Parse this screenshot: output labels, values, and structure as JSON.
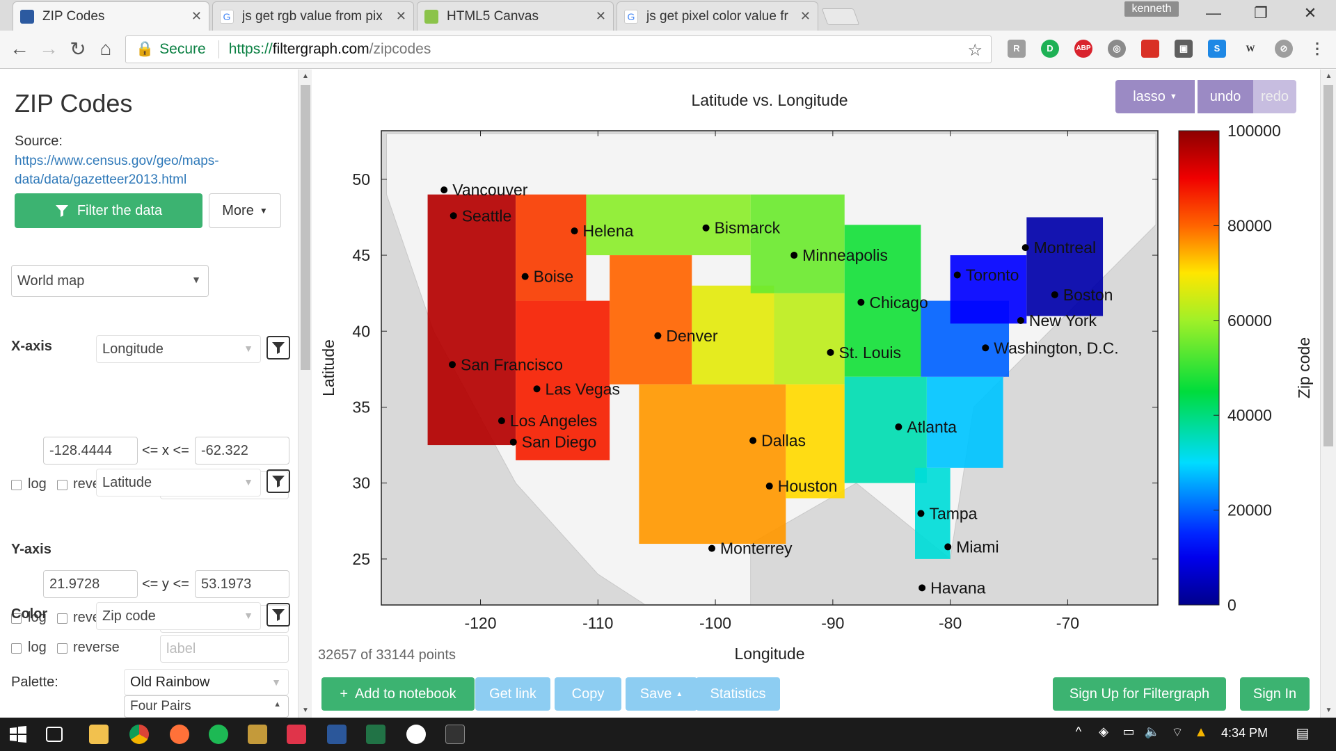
{
  "browser": {
    "tabs": [
      {
        "title": "ZIP Codes",
        "icon": "filtergraph-icon",
        "active": true
      },
      {
        "title": "js get rgb value from pix",
        "icon": "google-icon"
      },
      {
        "title": "HTML5 Canvas",
        "icon": "html5-icon"
      },
      {
        "title": "js get pixel color value fr",
        "icon": "google-icon"
      }
    ],
    "user": "kenneth",
    "address": {
      "secure_label": "Secure",
      "scheme": "https://",
      "host": "filtergraph.com",
      "path": "/zipcodes"
    }
  },
  "sidebar": {
    "title": "ZIP Codes",
    "source_label": "Source:",
    "source_link": "https://www.census.gov/geo/maps-data/data/gazetteer2013.html",
    "filter_button": "Filter the data",
    "more_button": "More",
    "background_select": "World map",
    "xaxis": {
      "label": "X-axis",
      "field": "Longitude",
      "min": "-128.4444",
      "op": "<= x <=",
      "max": "-62.322",
      "log": "log",
      "reverse": "reverse",
      "label_placeholder": "label"
    },
    "yaxis": {
      "label": "Y-axis",
      "field": "Latitude",
      "min": "21.9728",
      "op": "<= y <=",
      "max": "53.1973",
      "log": "log",
      "reverse": "reverse",
      "label_placeholder": "label"
    },
    "color": {
      "label": "Color",
      "field": "Zip code",
      "log": "log",
      "reverse": "reverse",
      "label_placeholder": "label"
    },
    "palette": {
      "label": "Palette:",
      "value": "Old Rainbow",
      "option": "Four Pairs"
    }
  },
  "toolbar": {
    "lasso": "lasso",
    "undo": "undo",
    "redo": "redo"
  },
  "status": {
    "points": "32657 of 33144 points"
  },
  "actions": {
    "add": "Add to notebook",
    "get_link": "Get link",
    "copy": "Copy",
    "save": "Save",
    "statistics": "Statistics",
    "signup": "Sign Up for Filtergraph",
    "signin": "Sign In"
  },
  "taskbar": {
    "time": "4:34 PM"
  },
  "colors": {
    "green": "#3cb371",
    "purple": "#9b8ac4",
    "light_blue": "#8dcdf2",
    "link": "#2f79b9"
  },
  "chart_data": {
    "type": "scatter",
    "title": "Latitude vs. Longitude",
    "xlabel": "Longitude",
    "ylabel": "Latitude",
    "xlim": [
      -128.4444,
      -62.322
    ],
    "ylim": [
      21.9728,
      53.1973
    ],
    "xticks": [
      -120,
      -110,
      -100,
      -90,
      -80,
      -70
    ],
    "yticks": [
      25,
      30,
      35,
      40,
      45,
      50
    ],
    "colorbar": {
      "label": "Zip code",
      "ticks": [
        0,
        20000,
        40000,
        60000,
        80000,
        100000
      ]
    },
    "cities": [
      {
        "name": "Vancouver",
        "lon": -123.1,
        "lat": 49.3
      },
      {
        "name": "Seattle",
        "lon": -122.3,
        "lat": 47.6
      },
      {
        "name": "Helena",
        "lon": -112.0,
        "lat": 46.6
      },
      {
        "name": "Bismarck",
        "lon": -100.8,
        "lat": 46.8
      },
      {
        "name": "Minneapolis",
        "lon": -93.3,
        "lat": 45.0
      },
      {
        "name": "Montreal",
        "lon": -73.6,
        "lat": 45.5
      },
      {
        "name": "Boise",
        "lon": -116.2,
        "lat": 43.6
      },
      {
        "name": "Toronto",
        "lon": -79.4,
        "lat": 43.7
      },
      {
        "name": "Chicago",
        "lon": -87.6,
        "lat": 41.9
      },
      {
        "name": "Boston",
        "lon": -71.1,
        "lat": 42.4
      },
      {
        "name": "New York",
        "lon": -74.0,
        "lat": 40.7
      },
      {
        "name": "Denver",
        "lon": -104.9,
        "lat": 39.7
      },
      {
        "name": "St. Louis",
        "lon": -90.2,
        "lat": 38.6
      },
      {
        "name": "Washington, D.C.",
        "lon": -77.0,
        "lat": 38.9
      },
      {
        "name": "San Francisco",
        "lon": -122.4,
        "lat": 37.8
      },
      {
        "name": "Las Vegas",
        "lon": -115.2,
        "lat": 36.2
      },
      {
        "name": "Los Angeles",
        "lon": -118.2,
        "lat": 34.1
      },
      {
        "name": "Atlanta",
        "lon": -84.4,
        "lat": 33.7
      },
      {
        "name": "San Diego",
        "lon": -117.2,
        "lat": 32.7
      },
      {
        "name": "Dallas",
        "lon": -96.8,
        "lat": 32.8
      },
      {
        "name": "Houston",
        "lon": -95.4,
        "lat": 29.8
      },
      {
        "name": "Tampa",
        "lon": -82.5,
        "lat": 28.0
      },
      {
        "name": "Miami",
        "lon": -80.2,
        "lat": 25.8
      },
      {
        "name": "Monterrey",
        "lon": -100.3,
        "lat": 25.7
      },
      {
        "name": "Havana",
        "lon": -82.4,
        "lat": 23.1
      }
    ],
    "regions": [
      {
        "lon": [
          -124.5,
          -117.0
        ],
        "lat": [
          32.5,
          49.0
        ],
        "zip": 96000
      },
      {
        "lon": [
          -117.0,
          -111.0
        ],
        "lat": [
          42.0,
          49.0
        ],
        "zip": 84000
      },
      {
        "lon": [
          -117.0,
          -109.0
        ],
        "lat": [
          31.5,
          42.0
        ],
        "zip": 87000
      },
      {
        "lon": [
          -111.0,
          -97.0
        ],
        "lat": [
          45.0,
          49.0
        ],
        "zip": 58000
      },
      {
        "lon": [
          -109.0,
          -102.0
        ],
        "lat": [
          36.5,
          45.0
        ],
        "zip": 80000
      },
      {
        "lon": [
          -106.5,
          -94.0
        ],
        "lat": [
          26.0,
          36.5
        ],
        "zip": 76000
      },
      {
        "lon": [
          -102.0,
          -95.0
        ],
        "lat": [
          36.5,
          43.0
        ],
        "zip": 67000
      },
      {
        "lon": [
          -97.0,
          -89.0
        ],
        "lat": [
          42.5,
          49.0
        ],
        "zip": 55000
      },
      {
        "lon": [
          -95.0,
          -89.0
        ],
        "lat": [
          36.5,
          42.5
        ],
        "zip": 63000
      },
      {
        "lon": [
          -94.0,
          -89.0
        ],
        "lat": [
          29.0,
          36.5
        ],
        "zip": 71000
      },
      {
        "lon": [
          -89.0,
          -82.5
        ],
        "lat": [
          37.0,
          47.0
        ],
        "zip": 47000
      },
      {
        "lon": [
          -89.0,
          -82.0
        ],
        "lat": [
          30.0,
          37.0
        ],
        "zip": 36000
      },
      {
        "lon": [
          -82.0,
          -75.5
        ],
        "lat": [
          31.0,
          37.0
        ],
        "zip": 28000
      },
      {
        "lon": [
          -83.0,
          -80.0
        ],
        "lat": [
          25.0,
          31.0
        ],
        "zip": 33000
      },
      {
        "lon": [
          -82.5,
          -75.0
        ],
        "lat": [
          37.0,
          42.0
        ],
        "zip": 20000
      },
      {
        "lon": [
          -80.0,
          -73.5
        ],
        "lat": [
          40.5,
          45.0
        ],
        "zip": 12000
      },
      {
        "lon": [
          -73.5,
          -67.0
        ],
        "lat": [
          41.0,
          47.5
        ],
        "zip": 3000
      }
    ]
  }
}
